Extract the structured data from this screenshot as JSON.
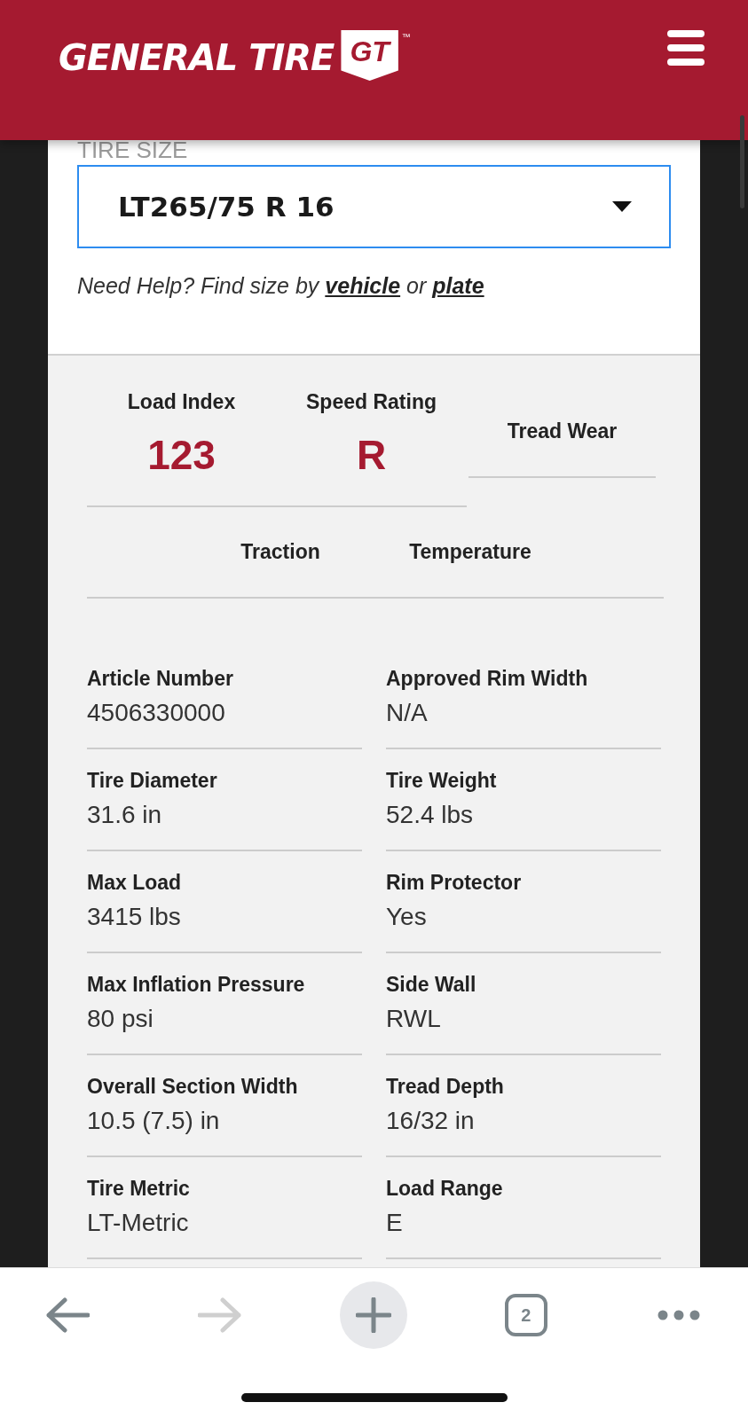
{
  "header": {
    "brand": "GENERAL TIRE",
    "badge": "GT",
    "trademark": "™"
  },
  "tire_size": {
    "label": "TIRE SIZE",
    "value": "LT265/75 R 16",
    "help": "*Need Help? Find size by* ",
    "links": [
      "vehicle",
      "plate"
    ],
    "joiner": "or"
  },
  "ratings": [
    {
      "label": "Load Index",
      "value": "123"
    },
    {
      "label": "Speed Rating",
      "value": "R"
    },
    {
      "label": "Tread Wear"
    }
  ],
  "grades": [
    {
      "label": "Traction"
    },
    {
      "label": "Temperature"
    }
  ],
  "specs": [
    {
      "label": "Article Number",
      "value": "4506330000"
    },
    {
      "label": "Approved Rim Width",
      "value": "N/A"
    },
    {
      "label": "Tire Diameter",
      "value": "31.6 in"
    },
    {
      "label": "Tire Weight",
      "value": "52.4 lbs"
    },
    {
      "label": "Max Load",
      "value": "3415 lbs"
    },
    {
      "label": "Rim Protector",
      "value": "Yes"
    },
    {
      "label": "Max Inflation Pressure",
      "value": "80 psi"
    },
    {
      "label": "Side Wall",
      "value": "RWL"
    },
    {
      "label": "Overall Section Width",
      "value": "10.5 (7.5) in"
    },
    {
      "label": "Tread Depth",
      "value": "16/32 in"
    },
    {
      "label": "Tire Metric",
      "value": "LT-Metric"
    },
    {
      "label": "Load Range",
      "value": "E"
    }
  ],
  "toolbar": [
    {
      "kind": "back",
      "disabled": false
    },
    {
      "kind": "forward",
      "disabled": true
    },
    {
      "kind": "new-tab"
    },
    {
      "kind": "tabs",
      "count": "2"
    },
    {
      "kind": "more"
    }
  ]
}
